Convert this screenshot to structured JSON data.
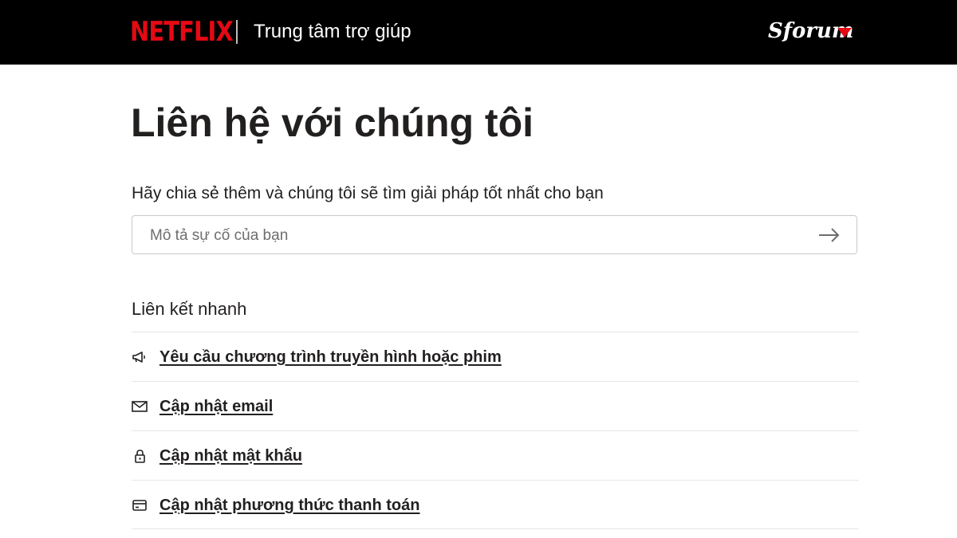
{
  "header": {
    "logo_text": "NETFLIX",
    "title": "Trung tâm trợ giúp",
    "watermark": "Sforum",
    "brand_color": "#e50914"
  },
  "main": {
    "heading": "Liên hệ với chúng tôi",
    "prompt": "Hãy chia sẻ thêm và chúng tôi sẽ tìm giải pháp tốt nhất cho bạn",
    "search": {
      "value": "",
      "placeholder": "Mô tả sự cố của bạn",
      "submit_icon": "arrow-right-icon"
    },
    "quick_links": {
      "heading": "Liên kết nhanh",
      "items": [
        {
          "label": "Yêu cầu chương trình truyền hình hoặc phim",
          "icon": "megaphone-icon"
        },
        {
          "label": "Cập nhật email",
          "icon": "envelope-icon"
        },
        {
          "label": "Cập nhật mật khẩu",
          "icon": "lock-icon"
        },
        {
          "label": "Cập nhật phương thức thanh toán",
          "icon": "credit-card-icon"
        }
      ]
    }
  }
}
